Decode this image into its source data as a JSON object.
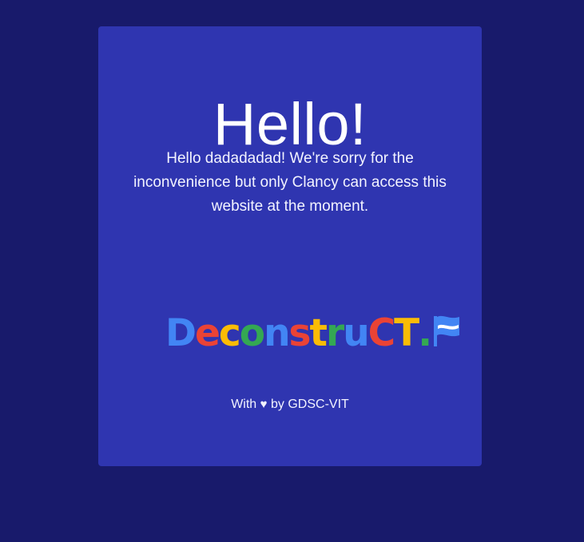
{
  "card": {
    "heading": "Hello!",
    "message": "Hello dadadadad! We're sorry for the inconvenience but only Clancy can access this website at the moment."
  },
  "logo": {
    "text": "DeconstruCT.",
    "letters": [
      {
        "char": "D",
        "color": "#4285f4"
      },
      {
        "char": "e",
        "color": "#ea4335"
      },
      {
        "char": "c",
        "color": "#fbbc05"
      },
      {
        "char": "o",
        "color": "#34a853"
      },
      {
        "char": "n",
        "color": "#4285f4"
      },
      {
        "char": "s",
        "color": "#ea4335"
      },
      {
        "char": "t",
        "color": "#fbbc05"
      },
      {
        "char": "r",
        "color": "#34a853"
      },
      {
        "char": "u",
        "color": "#4285f4"
      },
      {
        "char": "C",
        "color": "#ea4335"
      },
      {
        "char": "T",
        "color": "#fbbc05"
      },
      {
        "char": ".",
        "color": "#34a853"
      }
    ],
    "flag_icon": "flag-icon",
    "flag_color": "#4285f4"
  },
  "footer": {
    "prefix": "With",
    "heart_icon": "♥",
    "suffix": "by GDSC-VIT"
  },
  "colors": {
    "background": "#181a6b",
    "card": "#2f35b0",
    "text": "#ffffff"
  }
}
